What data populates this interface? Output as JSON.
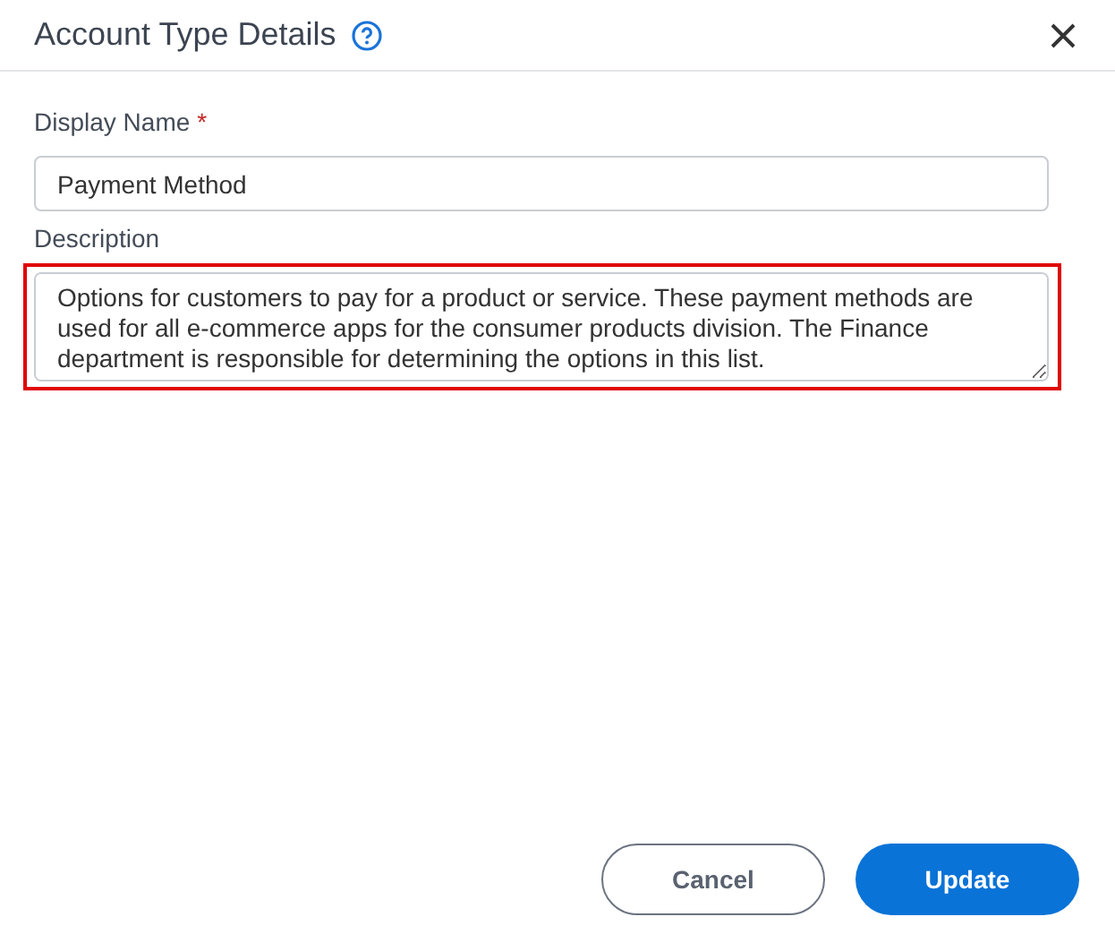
{
  "dialog": {
    "title": "Account Type Details"
  },
  "fields": [
    {
      "kind": "input",
      "label": "Display Name",
      "required_mark": "*",
      "value": "Payment Method",
      "highlighted": false
    },
    {
      "kind": "textarea",
      "label": "Description",
      "value": "Options for customers to pay for a product or service. These payment methods are used for all e-commerce apps for the consumer products division. The Finance department is responsible for determining the options in this list.",
      "highlighted": true
    }
  ],
  "buttons": [
    {
      "label": "Cancel",
      "kind": "secondary"
    },
    {
      "label": "Update",
      "kind": "primary"
    }
  ]
}
